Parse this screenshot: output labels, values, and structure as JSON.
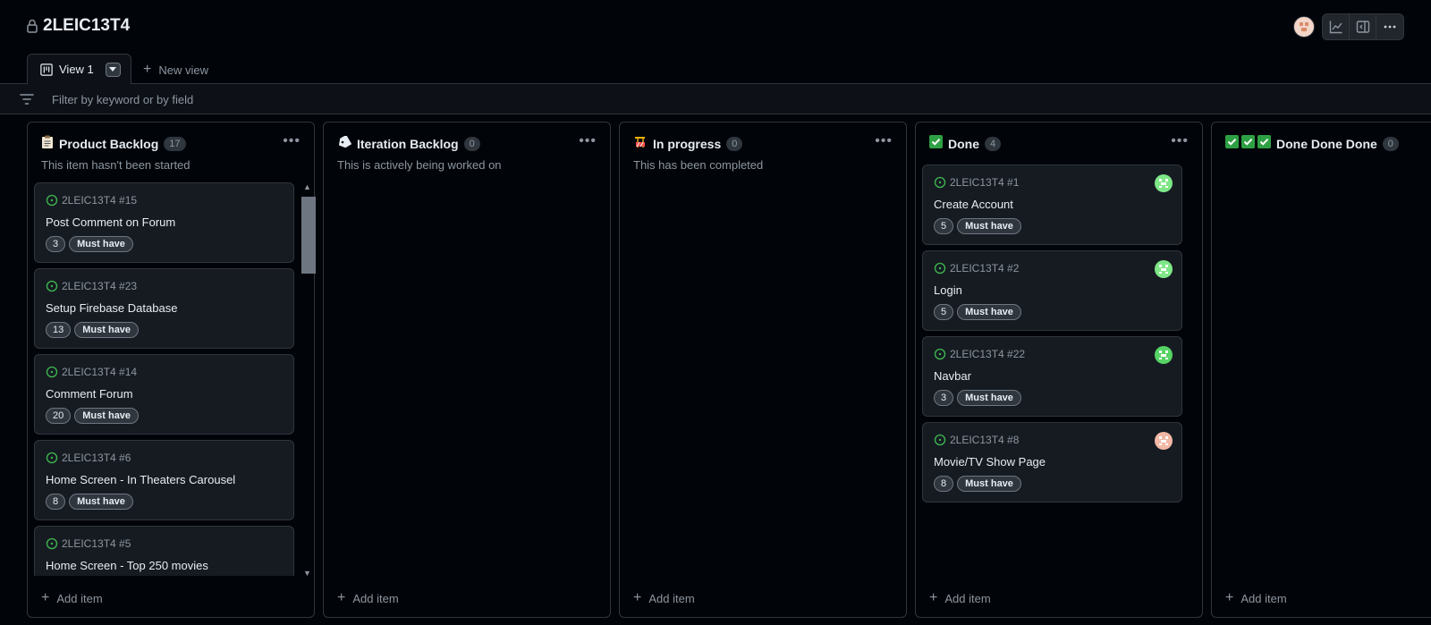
{
  "project": {
    "title": "2LEIC13T4"
  },
  "views": {
    "active_tab": "View 1",
    "new_view": "New view"
  },
  "filter": {
    "placeholder": "Filter by keyword or by field"
  },
  "columns": [
    {
      "title": "Product Backlog",
      "count": "17",
      "description": "This item hasn't been started",
      "emoji": [
        "clipboard-icon"
      ],
      "add": "Add item",
      "cards": [
        {
          "ref": "2LEIC13T4 #15",
          "title": "Post Comment on Forum",
          "estimate": "3",
          "priority": "Must have"
        },
        {
          "ref": "2LEIC13T4 #23",
          "title": "Setup Firebase Database",
          "estimate": "13",
          "priority": "Must have"
        },
        {
          "ref": "2LEIC13T4 #14",
          "title": "Comment Forum",
          "estimate": "20",
          "priority": "Must have"
        },
        {
          "ref": "2LEIC13T4 #6",
          "title": "Home Screen - In Theaters Carousel",
          "estimate": "8",
          "priority": "Must have"
        },
        {
          "ref": "2LEIC13T4 #5",
          "title": "Home Screen - Top 250 movies",
          "estimate": "",
          "priority": ""
        }
      ]
    },
    {
      "title": "Iteration Backlog",
      "count": "0",
      "description": "This is actively being worked on",
      "emoji": [
        "label-icon"
      ],
      "add": "Add item",
      "cards": []
    },
    {
      "title": "In progress",
      "count": "0",
      "description": "This has been completed",
      "emoji": [
        "construction-icon"
      ],
      "add": "Add item",
      "cards": []
    },
    {
      "title": "Done",
      "count": "4",
      "description": "",
      "emoji": [
        "check-icon"
      ],
      "add": "Add item",
      "cards": [
        {
          "ref": "2LEIC13T4 #1",
          "title": "Create Account",
          "estimate": "5",
          "priority": "Must have",
          "avatar_color": "#7ee787"
        },
        {
          "ref": "2LEIC13T4 #2",
          "title": "Login",
          "estimate": "5",
          "priority": "Must have",
          "avatar_color": "#7ee787"
        },
        {
          "ref": "2LEIC13T4 #22",
          "title": "Navbar",
          "estimate": "3",
          "priority": "Must have",
          "avatar_color": "#56d364"
        },
        {
          "ref": "2LEIC13T4 #8",
          "title": "Movie/TV Show Page",
          "estimate": "8",
          "priority": "Must have",
          "avatar_color": "#f2b8a6"
        }
      ]
    },
    {
      "title": "Done Done Done",
      "count": "0",
      "description": "",
      "emoji": [
        "check-icon",
        "check-icon",
        "check-icon"
      ],
      "add": "Add item",
      "cards": []
    }
  ],
  "colors": {
    "open_issue": "#3fb950",
    "check": "#2ea043",
    "bg": "#010409",
    "border": "#30363d"
  }
}
